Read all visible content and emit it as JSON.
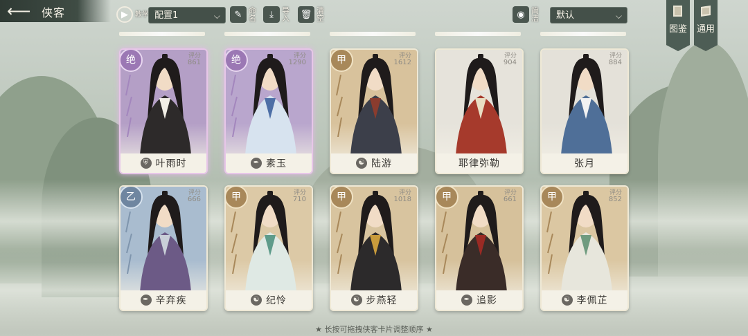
{
  "header": {
    "title": "侠客",
    "tutorial_label": "教学",
    "config_select": "配置1",
    "rename_label": "命名",
    "import_label": "导入",
    "clear_label": "清空",
    "simplify_label": "简洁",
    "sort_select": "默认",
    "codex_label": "图鉴",
    "general_label": "通用"
  },
  "score_label": "评分",
  "cards": [
    {
      "name": "叶雨时",
      "grade": "绝",
      "score": "861",
      "selected": true,
      "bg": "#b49fc6",
      "robe": "#2d2a2a",
      "accent": "#f1eee6",
      "emblem": "shield"
    },
    {
      "name": "素玉",
      "grade": "绝",
      "score": "1290",
      "selected": true,
      "bg": "#b9a6cd",
      "robe": "#d7e3ef",
      "accent": "#4d6fa6",
      "emblem": "brush"
    },
    {
      "name": "陆游",
      "grade": "甲",
      "score": "1612",
      "selected": false,
      "bg": "#d8c29c",
      "robe": "#3c3f4a",
      "accent": "#8a3c2e",
      "emblem": "yinyang"
    },
    {
      "name": "耶律弥勒",
      "grade": "",
      "score": "904",
      "selected": false,
      "bg": "#e6e3db",
      "robe": "#a63a2c",
      "accent": "#e9dfc4",
      "emblem": ""
    },
    {
      "name": "张月",
      "grade": "",
      "score": "884",
      "selected": false,
      "bg": "#e4e1d9",
      "robe": "#4f6f98",
      "accent": "#f2f2f2",
      "emblem": ""
    },
    {
      "name": "辛弃疾",
      "grade": "乙",
      "score": "666",
      "selected": false,
      "bg": "#a9bccf",
      "robe": "#6c5a86",
      "accent": "#c9cfd8",
      "emblem": "brush"
    },
    {
      "name": "纪怜",
      "grade": "甲",
      "score": "710",
      "selected": false,
      "bg": "#dcc9a6",
      "robe": "#dfe9e4",
      "accent": "#5e9b8a",
      "emblem": "yinyang"
    },
    {
      "name": "步燕轻",
      "grade": "甲",
      "score": "1018",
      "selected": false,
      "bg": "#d8c49f",
      "robe": "#2c2a2b",
      "accent": "#c89b3c",
      "emblem": "yinyang"
    },
    {
      "name": "追影",
      "grade": "甲",
      "score": "661",
      "selected": false,
      "bg": "#d6c19b",
      "robe": "#3a2c28",
      "accent": "#9a2a24",
      "emblem": "brush"
    },
    {
      "name": "李佩芷",
      "grade": "甲",
      "score": "852",
      "selected": false,
      "bg": "#dbc7a2",
      "robe": "#e7e6dc",
      "accent": "#6f9b7f",
      "emblem": "yinyang"
    }
  ],
  "footer_hint": "★ 长按可拖拽侠客卡片调整顺序 ★",
  "colors": {
    "topbar": "#3f4c44",
    "accent_jue": "#9b78b4",
    "accent_jia": "#a8885a",
    "accent_yi": "#6f86a0"
  }
}
